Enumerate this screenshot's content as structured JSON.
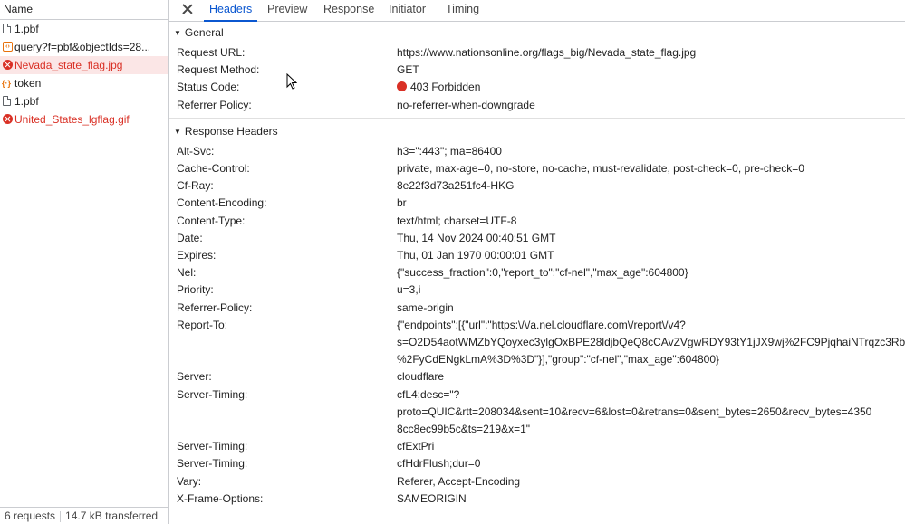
{
  "left_panel": {
    "header": "Name",
    "requests": [
      {
        "label": "1.pbf",
        "icon": "file-icon",
        "error": false,
        "selected": false
      },
      {
        "label": "query?f=pbf&objectIds=28...",
        "icon": "xhr-icon",
        "error": false,
        "selected": false
      },
      {
        "label": "Nevada_state_flag.jpg",
        "icon": "error-icon",
        "error": true,
        "selected": true
      },
      {
        "label": "token",
        "icon": "json-icon",
        "error": false,
        "selected": false
      },
      {
        "label": "1.pbf",
        "icon": "file-icon",
        "error": false,
        "selected": false
      },
      {
        "label": "United_States_lgflag.gif",
        "icon": "error-icon",
        "error": true,
        "selected": false
      }
    ],
    "status_bar": {
      "requests": "6 requests",
      "transferred": "14.7 kB transferred"
    }
  },
  "tabs": [
    {
      "label": "Headers",
      "active": true
    },
    {
      "label": "Preview",
      "active": false
    },
    {
      "label": "Response",
      "active": false
    },
    {
      "label": "Initiator",
      "active": false
    },
    {
      "label": "Timing",
      "active": false
    }
  ],
  "general": {
    "title": "General",
    "rows": [
      {
        "key": "Request URL:",
        "value": "https://www.nationsonline.org/flags_big/Nevada_state_flag.jpg"
      },
      {
        "key": "Request Method:",
        "value": "GET"
      },
      {
        "key": "Status Code:",
        "value": "403 Forbidden",
        "status_color": "#d93025"
      },
      {
        "key": "Referrer Policy:",
        "value": "no-referrer-when-downgrade"
      }
    ]
  },
  "response_headers": {
    "title": "Response Headers",
    "rows": [
      {
        "key": "Alt-Svc:",
        "lines": [
          "h3=\":443\"; ma=86400"
        ]
      },
      {
        "key": "Cache-Control:",
        "lines": [
          "private, max-age=0, no-store, no-cache, must-revalidate, post-check=0, pre-check=0"
        ]
      },
      {
        "key": "Cf-Ray:",
        "lines": [
          "8e22f3d73a251fc4-HKG"
        ]
      },
      {
        "key": "Content-Encoding:",
        "lines": [
          "br"
        ]
      },
      {
        "key": "Content-Type:",
        "lines": [
          "text/html; charset=UTF-8"
        ]
      },
      {
        "key": "Date:",
        "lines": [
          "Thu, 14 Nov 2024 00:40:51 GMT"
        ]
      },
      {
        "key": "Expires:",
        "lines": [
          "Thu, 01 Jan 1970 00:00:01 GMT"
        ]
      },
      {
        "key": "Nel:",
        "lines": [
          "{\"success_fraction\":0,\"report_to\":\"cf-nel\",\"max_age\":604800}"
        ]
      },
      {
        "key": "Priority:",
        "lines": [
          "u=3,i"
        ]
      },
      {
        "key": "Referrer-Policy:",
        "lines": [
          "same-origin"
        ]
      },
      {
        "key": "Report-To:",
        "lines": [
          "{\"endpoints\":[{\"url\":\"https:\\/\\/a.nel.cloudflare.com\\/report\\/v4?",
          "s=O2D54aotWMZbYQoyxec3ylgOxBPE28ldjbQeQ8cCAvZVgwRDY93tY1jJX9wj%2FC9PjqhaiNTrqzc3Rb",
          "%2FyCdENgkLmA%3D%3D\"}],\"group\":\"cf-nel\",\"max_age\":604800}"
        ]
      },
      {
        "key": "Server:",
        "lines": [
          "cloudflare"
        ]
      },
      {
        "key": "Server-Timing:",
        "lines": [
          "cfL4;desc=\"?",
          "proto=QUIC&rtt=208034&sent=10&recv=6&lost=0&retrans=0&sent_bytes=2650&recv_bytes=4350",
          "8cc8ec99b5c&ts=219&x=1\""
        ]
      },
      {
        "key": "Server-Timing:",
        "lines": [
          "cfExtPri"
        ]
      },
      {
        "key": "Server-Timing:",
        "lines": [
          "cfHdrFlush;dur=0"
        ]
      },
      {
        "key": "Vary:",
        "lines": [
          "Referer, Accept-Encoding"
        ]
      },
      {
        "key": "X-Frame-Options:",
        "lines": [
          "SAMEORIGIN"
        ]
      }
    ]
  }
}
